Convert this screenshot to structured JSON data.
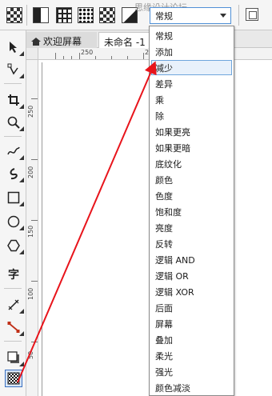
{
  "watermark": "思缘设计论坛",
  "property_bar": {
    "mode_value": "常规",
    "icons": [
      "transparency-checker-icon",
      "half-tone-icon",
      "grid-pattern-icon",
      "dot-pattern-icon",
      "corner-fade-icon",
      "freeze-icon"
    ]
  },
  "tabs": {
    "welcome": "欢迎屏幕",
    "document": "未命名 -1"
  },
  "ruler": {
    "h_labels": [
      "250",
      "200"
    ],
    "v_labels": [
      "250",
      "200",
      "150",
      "100",
      "50"
    ]
  },
  "toolbox": {
    "tools": [
      "pick-tool-icon",
      "shape-tool-icon",
      "crop-tool-icon",
      "zoom-tool-icon",
      "freehand-tool-icon",
      "artistic-media-icon",
      "rectangle-tool-icon",
      "ellipse-tool-icon",
      "polygon-tool-icon",
      "text-tool-icon",
      "parallel-dimension-icon",
      "connector-tool-icon",
      "drop-shadow-icon",
      "transparency-tool-icon"
    ],
    "text_tool_label": "字"
  },
  "dropdown": {
    "items": [
      {
        "label": "常规"
      },
      {
        "label": "添加"
      },
      {
        "label": "减少",
        "selected": true
      },
      {
        "label": "差异"
      },
      {
        "label": "乘"
      },
      {
        "label": "除"
      },
      {
        "label": "如果更亮"
      },
      {
        "label": "如果更暗"
      },
      {
        "label": "底纹化"
      },
      {
        "label": "颜色"
      },
      {
        "label": "色度"
      },
      {
        "label": "饱和度"
      },
      {
        "label": "亮度"
      },
      {
        "label": "反转"
      },
      {
        "label": "逻辑 AND"
      },
      {
        "label": "逻辑 OR"
      },
      {
        "label": "逻辑 XOR"
      },
      {
        "label": "后面"
      },
      {
        "label": "屏幕"
      },
      {
        "label": "叠加"
      },
      {
        "label": "柔光"
      },
      {
        "label": "强光"
      },
      {
        "label": "颜色减淡"
      }
    ]
  },
  "colors": {
    "arrow": "#e8141b",
    "selection_border": "#6fa6dc",
    "selection_fill": "#e8f1fb"
  }
}
